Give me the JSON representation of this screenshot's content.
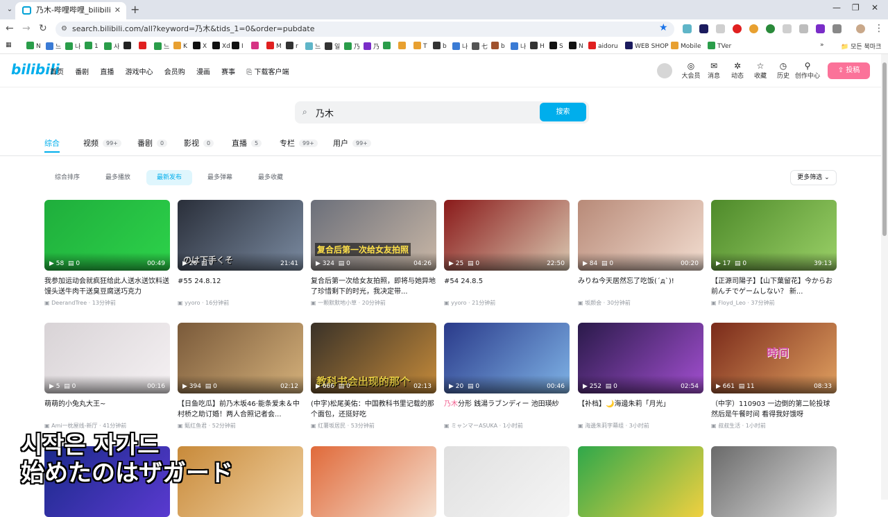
{
  "browser": {
    "tab_title": "乃木-哔哩哔哩_bilibili",
    "url": "search.bilibili.com/all?keyword=乃木&tids_1=0&order=pubdate",
    "bookmarks": [
      "N",
      "느",
      "나",
      "1",
      "사",
      "",
      "",
      "느",
      "K",
      "X",
      "Xd",
      "I",
      "",
      "M",
      "r",
      "느",
      "일",
      "乃",
      "乃",
      "",
      "",
      "T",
      "b",
      "나",
      "七",
      "b",
      "나",
      "H",
      "S",
      "N",
      "aidoru",
      "WEB SHOP",
      "Mobile",
      "TVer"
    ],
    "bookmarks_folder": "모든 북마크",
    "colors": {
      "tabbar": "#dfe3eb",
      "accent": "#1a73e8"
    }
  },
  "header": {
    "logo": "bilibili",
    "nav": [
      "首页",
      "番剧",
      "直播",
      "游戏中心",
      "会员购",
      "漫画",
      "赛事",
      "下载客户端"
    ],
    "icons": [
      {
        "label": "大会员",
        "icon": "vip-icon"
      },
      {
        "label": "消息",
        "icon": "message-icon"
      },
      {
        "label": "动态",
        "icon": "dynamic-icon"
      },
      {
        "label": "收藏",
        "icon": "favorite-icon"
      },
      {
        "label": "历史",
        "icon": "history-icon"
      },
      {
        "label": "创作中心",
        "icon": "creator-icon"
      }
    ],
    "upload": "投稿",
    "colors": {
      "brand": "#00aeec",
      "upload": "#fb7299"
    }
  },
  "search": {
    "query": "乃木",
    "button": "搜索"
  },
  "tabs": [
    {
      "label": "综合",
      "count": ""
    },
    {
      "label": "视频",
      "count": "99+"
    },
    {
      "label": "番剧",
      "count": "0"
    },
    {
      "label": "影视",
      "count": "0"
    },
    {
      "label": "直播",
      "count": "5"
    },
    {
      "label": "专栏",
      "count": "99+"
    },
    {
      "label": "用户",
      "count": "99+"
    }
  ],
  "sort": [
    "综合排序",
    "最多播放",
    "最新发布",
    "最多弹幕",
    "最多收藏"
  ],
  "sort_active": "最新发布",
  "more_filter": "更多筛选",
  "videos": [
    {
      "views": "58",
      "danmaku": "0",
      "duration": "00:49",
      "title": "我参加运动会就疯狂给此人送水送饮料送馒头送牛肉干送臭豆腐送巧克力",
      "author": "DeerandTree",
      "time": "13分钟前"
    },
    {
      "views": "26",
      "danmaku": "0",
      "duration": "21:41",
      "title": "#55 24.8.12",
      "author": "yyoro",
      "time": "16分钟前",
      "overlay": "のは下手くそ"
    },
    {
      "views": "324",
      "danmaku": "0",
      "duration": "04:26",
      "title": "复合后第一次给女友拍照，即将与她异地了珍惜剩下的时光，我决定带...",
      "author": "一颗默默地小草",
      "time": "20分钟前",
      "overlay": "复合后第一次给女友拍照"
    },
    {
      "views": "25",
      "danmaku": "0",
      "duration": "22:50",
      "title": "#54 24.8.5",
      "author": "yyoro",
      "time": "21分钟前"
    },
    {
      "views": "84",
      "danmaku": "0",
      "duration": "00:20",
      "title": "みりね今天居然忘了吃饭(´д`)!",
      "author": "坂颜会",
      "time": "30分钟前"
    },
    {
      "views": "17",
      "danmaku": "0",
      "duration": "39:13",
      "title": "【正源司陽子】【山下葉留花】今からお前んチでゲームしない？ 新...",
      "author": "Floyd_Leo",
      "time": "37分钟前"
    },
    {
      "views": "5",
      "danmaku": "0",
      "duration": "00:16",
      "title": "萌萌的小兔丸大王~",
      "author": "Ami一枕屋线-新厅",
      "time": "41分钟前"
    },
    {
      "views": "394",
      "danmaku": "0",
      "duration": "02:12",
      "title": "【日鱼吃瓜】前乃木坂46·能条爱未＆中村桥之助订婚！两人合照记者会...",
      "author": "甄红鱼君",
      "time": "52分钟前"
    },
    {
      "views": "666",
      "danmaku": "0",
      "duration": "02:13",
      "title": "(中字)松尾美佑：中国教科书里记载的那个面包，还挺好吃",
      "author": "红薯坂居民",
      "time": "53分钟前",
      "overlay": "教科书会出现的那个"
    },
    {
      "views": "20",
      "danmaku": "0",
      "duration": "00:46",
      "title": "乃木分形 銭湯ラブンディー 池田瑛紗",
      "highlight": "乃木",
      "author": "ミャンマーASUKA",
      "time": "1小时前"
    },
    {
      "views": "252",
      "danmaku": "0",
      "duration": "02:54",
      "title": "【补档】🌙海邊朱莉「月光」",
      "author": "海邊朱莉字幕组",
      "time": "3小时前"
    },
    {
      "views": "661",
      "danmaku": "11",
      "duration": "08:33",
      "title": "（中字）110903 一边倒的第二轮投球 然后是午餐时间 看得我好饿呀",
      "author": "叔叔生活",
      "time": "1小时前",
      "overlay": "時间"
    }
  ],
  "video_tiles": 6,
  "subtitles": {
    "line1": "시작은 자가드",
    "line2": "始めたのはザガード"
  }
}
